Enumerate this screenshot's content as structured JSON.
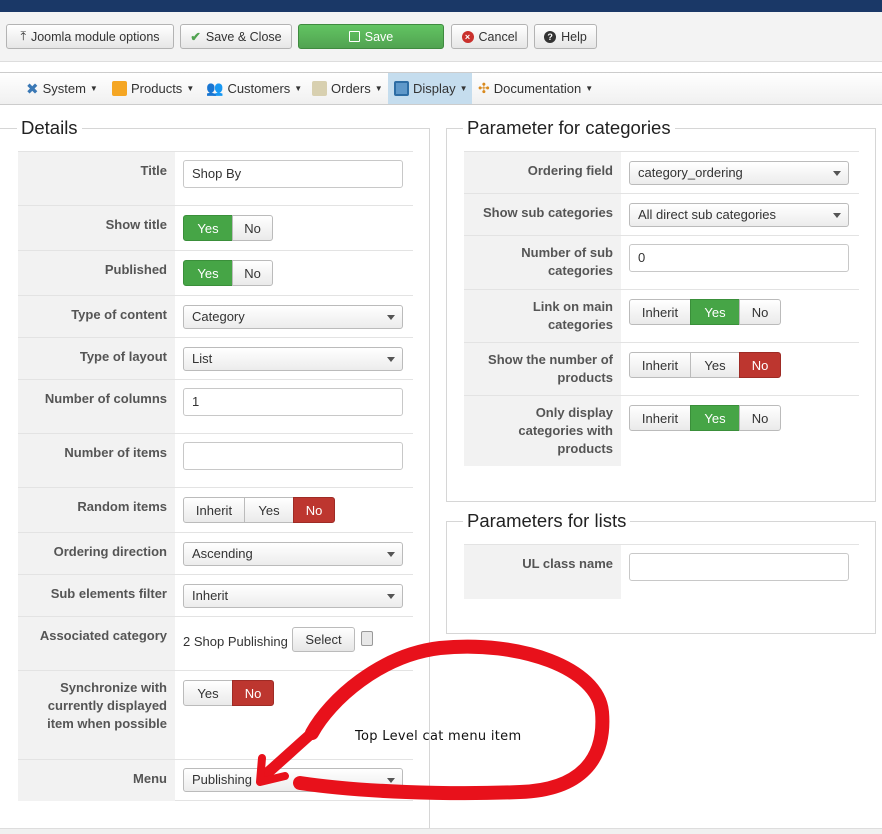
{
  "toolbar": {
    "module_options": "Joomla module options",
    "save_close": "Save & Close",
    "save": "Save",
    "cancel": "Cancel",
    "help": "Help"
  },
  "menu": {
    "system": "System",
    "products": "Products",
    "customers": "Customers",
    "orders": "Orders",
    "display": "Display",
    "documentation": "Documentation"
  },
  "details": {
    "legend": "Details",
    "title_label": "Title",
    "title_value": "Shop By",
    "show_title_label": "Show title",
    "published_label": "Published",
    "type_content_label": "Type of content",
    "type_content_value": "Category",
    "type_layout_label": "Type of layout",
    "type_layout_value": "List",
    "num_columns_label": "Number of columns",
    "num_columns_value": "1",
    "num_items_label": "Number of items",
    "num_items_value": "",
    "random_items_label": "Random items",
    "ordering_dir_label": "Ordering direction",
    "ordering_dir_value": "Ascending",
    "sub_filter_label": "Sub elements filter",
    "sub_filter_value": "Inherit",
    "assoc_cat_label": "Associated category",
    "assoc_cat_value": "2 Shop Publishing",
    "select_label": "Select",
    "sync_label": "Synchronize with currently displayed item when possible",
    "menu_label": "Menu",
    "menu_value": "Publishing"
  },
  "options": {
    "yes": "Yes",
    "no": "No",
    "inherit": "Inherit"
  },
  "categories": {
    "legend": "Parameter for categories",
    "ordering_field_label": "Ordering field",
    "ordering_field_value": "category_ordering",
    "show_sub_label": "Show sub categories",
    "show_sub_value": "All direct sub categories",
    "num_sub_label": "Number of sub categories",
    "num_sub_value": "0",
    "link_main_label": "Link on main categories",
    "show_num_products_label": "Show the number of products",
    "only_display_label": "Only display categories with products"
  },
  "lists": {
    "legend": "Parameters for lists",
    "ul_class_label": "UL class name",
    "ul_class_value": ""
  },
  "annotation": {
    "text": "Top Level cat menu item"
  },
  "colors": {
    "green": "#46a546",
    "red": "#bd362f",
    "annotation_red": "#e8111b"
  }
}
